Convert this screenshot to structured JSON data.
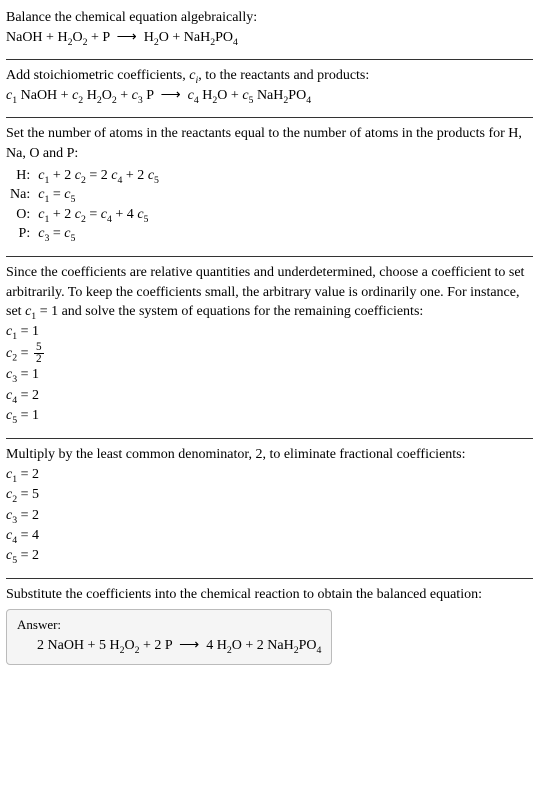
{
  "section1": {
    "intro": "Balance the chemical equation algebraically:",
    "eqn_html": "NaOH + H<span class=\"sub\">2</span>O<span class=\"sub\">2</span> + P &nbsp;⟶&nbsp; H<span class=\"sub\">2</span>O + NaH<span class=\"sub\">2</span>PO<span class=\"sub\">4</span>"
  },
  "section2": {
    "intro_html": "Add stoichiometric coefficients, <span class=\"ital\">c<span class=\"sub\">i</span></span>, to the reactants and products:",
    "eqn_html": "<span class=\"ital\">c</span><span class=\"sub\">1</span> NaOH + <span class=\"ital\">c</span><span class=\"sub\">2</span> H<span class=\"sub\">2</span>O<span class=\"sub\">2</span> + <span class=\"ital\">c</span><span class=\"sub\">3</span> P &nbsp;⟶&nbsp; <span class=\"ital\">c</span><span class=\"sub\">4</span> H<span class=\"sub\">2</span>O + <span class=\"ital\">c</span><span class=\"sub\">5</span> NaH<span class=\"sub\">2</span>PO<span class=\"sub\">4</span>"
  },
  "section3": {
    "intro": "Set the number of atoms in the reactants equal to the number of atoms in the products for H, Na, O and P:",
    "rows": [
      {
        "label": "H:",
        "eq_html": "<span class=\"ital\">c</span><span class=\"sub\">1</span> + 2 <span class=\"ital\">c</span><span class=\"sub\">2</span> = 2 <span class=\"ital\">c</span><span class=\"sub\">4</span> + 2 <span class=\"ital\">c</span><span class=\"sub\">5</span>"
      },
      {
        "label": "Na:",
        "eq_html": "<span class=\"ital\">c</span><span class=\"sub\">1</span> = <span class=\"ital\">c</span><span class=\"sub\">5</span>"
      },
      {
        "label": "O:",
        "eq_html": "<span class=\"ital\">c</span><span class=\"sub\">1</span> + 2 <span class=\"ital\">c</span><span class=\"sub\">2</span> = <span class=\"ital\">c</span><span class=\"sub\">4</span> + 4 <span class=\"ital\">c</span><span class=\"sub\">5</span>"
      },
      {
        "label": "P:",
        "eq_html": "<span class=\"ital\">c</span><span class=\"sub\">3</span> = <span class=\"ital\">c</span><span class=\"sub\">5</span>"
      }
    ]
  },
  "section4": {
    "intro_html": "Since the coefficients are relative quantities and underdetermined, choose a coefficient to set arbitrarily. To keep the coefficients small, the arbitrary value is ordinarily one. For instance, set <span class=\"ital\">c</span><span class=\"sub\">1</span> = 1 and solve the system of equations for the remaining coefficients:",
    "coeffs_html": [
      "<span class=\"ital\">c</span><span class=\"sub\">1</span> = 1",
      "<span class=\"ital\">c</span><span class=\"sub\">2</span> = <span class=\"frac\"><span class=\"num\">5</span><span class=\"den\">2</span></span>",
      "<span class=\"ital\">c</span><span class=\"sub\">3</span> = 1",
      "<span class=\"ital\">c</span><span class=\"sub\">4</span> = 2",
      "<span class=\"ital\">c</span><span class=\"sub\">5</span> = 1"
    ]
  },
  "section5": {
    "intro": "Multiply by the least common denominator, 2, to eliminate fractional coefficients:",
    "coeffs_html": [
      "<span class=\"ital\">c</span><span class=\"sub\">1</span> = 2",
      "<span class=\"ital\">c</span><span class=\"sub\">2</span> = 5",
      "<span class=\"ital\">c</span><span class=\"sub\">3</span> = 2",
      "<span class=\"ital\">c</span><span class=\"sub\">4</span> = 4",
      "<span class=\"ital\">c</span><span class=\"sub\">5</span> = 2"
    ]
  },
  "section6": {
    "intro": "Substitute the coefficients into the chemical reaction to obtain the balanced equation:",
    "answer_label": "Answer:",
    "answer_html": "2 NaOH + 5 H<span class=\"sub\">2</span>O<span class=\"sub\">2</span> + 2 P &nbsp;⟶&nbsp; 4 H<span class=\"sub\">2</span>O + 2 NaH<span class=\"sub\">2</span>PO<span class=\"sub\">4</span>"
  }
}
